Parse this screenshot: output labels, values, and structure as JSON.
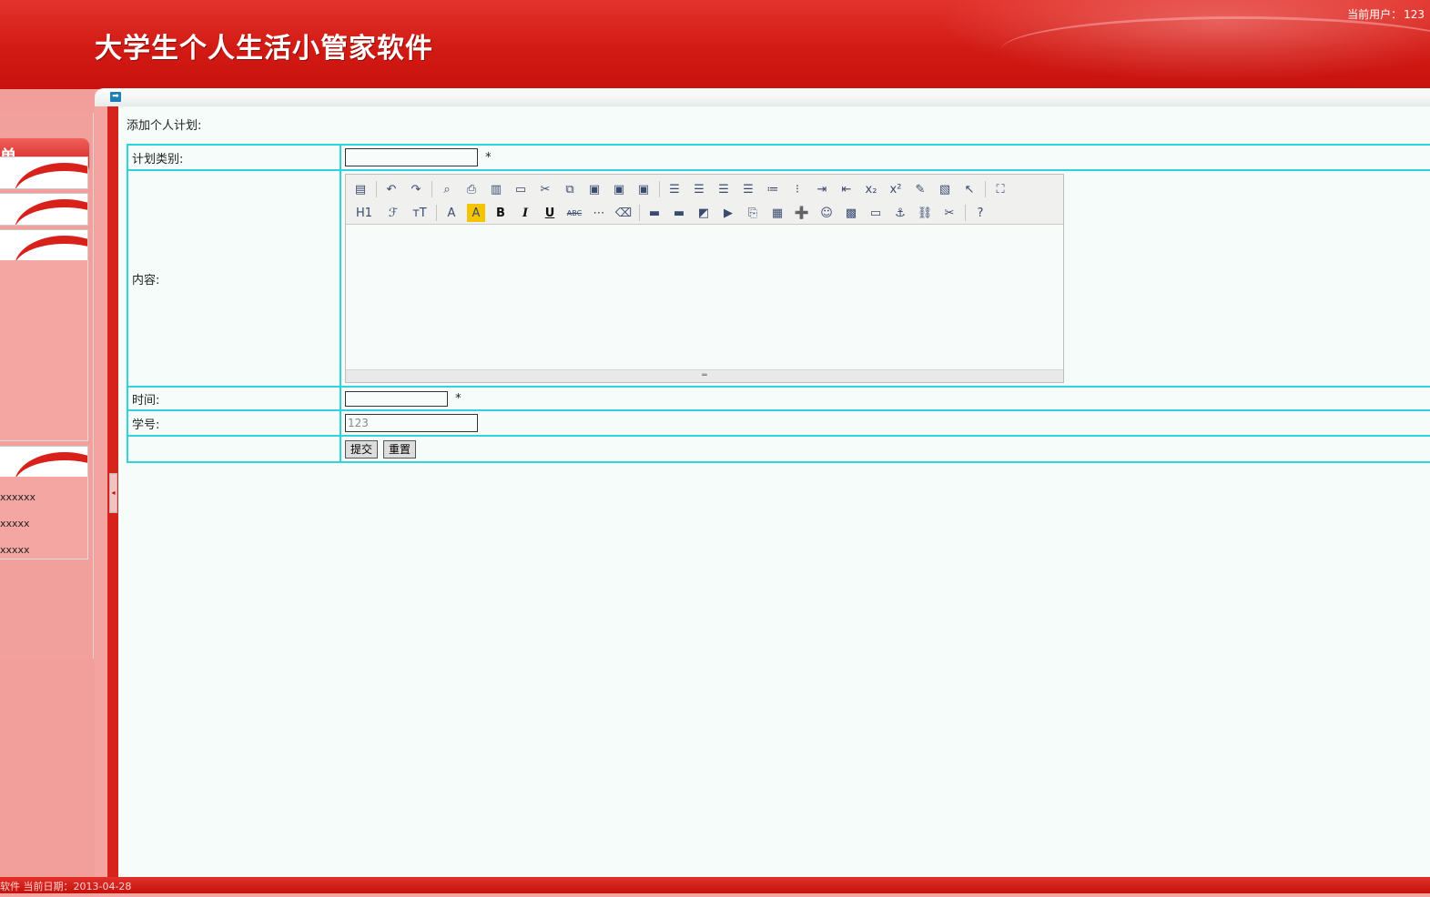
{
  "header": {
    "title": "大学生个人生活小管家软件",
    "current_user_label": "当前用户：",
    "current_user": "123"
  },
  "sidebar": {
    "menu_title": "单",
    "panel_links": [
      "xxxxxx",
      "xxxxx",
      "xxxxx"
    ]
  },
  "main": {
    "heading": "添加个人计划:",
    "form": {
      "category_label": "计划类别:",
      "category_value": "",
      "required_mark": "*",
      "content_label": "内容:",
      "time_label": "时间:",
      "time_value": "",
      "student_id_label": "学号:",
      "student_id_value": "123",
      "submit_label": "提交",
      "reset_label": "重置"
    },
    "editor": {
      "row1": [
        "source-icon",
        "undo-icon",
        "redo-icon",
        "preview-icon",
        "print-icon",
        "template-icon",
        "code-icon",
        "cut-icon",
        "copy-icon",
        "paste-icon",
        "paste-text-icon",
        "paste-word-icon",
        "align-left-icon",
        "align-center-icon",
        "align-right-icon",
        "align-justify-icon",
        "ordered-list-icon",
        "unordered-list-icon",
        "indent-icon",
        "outdent-icon",
        "subscript-icon",
        "superscript-icon",
        "clear-format-icon",
        "select-all-icon",
        "select-icon",
        "fullscreen-icon"
      ],
      "row2_text": {
        "h1": "H1",
        "font": "ℱ",
        "size": "тT",
        "fore_color": "A",
        "hilite": "A",
        "bold": "B",
        "italic": "I",
        "underline": "U",
        "strike": "ABC"
      }
    }
  },
  "footer": {
    "text": "软件 当前日期：2013-04-28"
  },
  "colors": {
    "header_red": "#d21a14",
    "sidebar_pink": "#f29f9c",
    "content_bg": "#f5fcfa",
    "table_border": "#2fd2dd"
  }
}
